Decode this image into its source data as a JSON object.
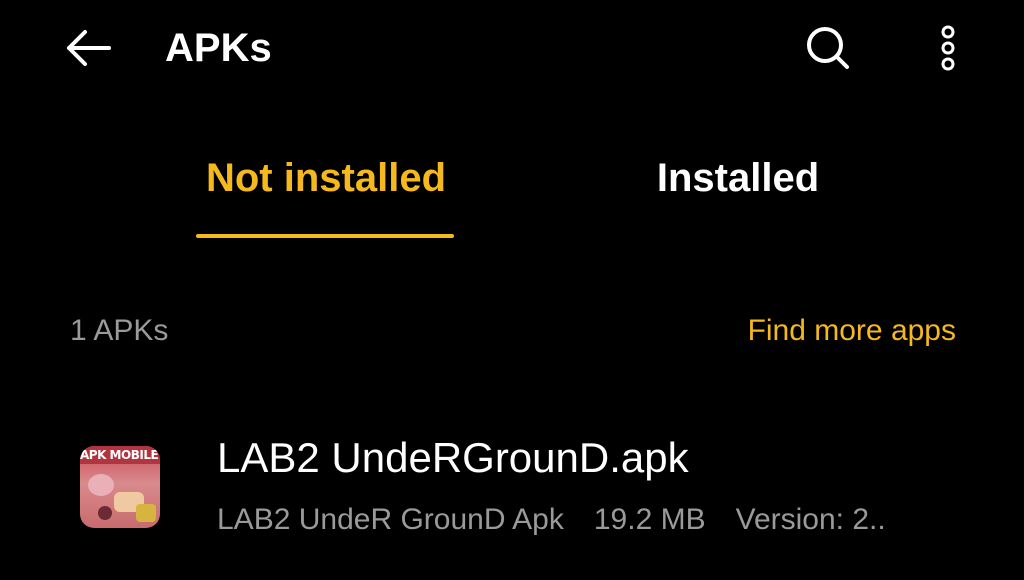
{
  "appbar": {
    "title": "APKs",
    "back_icon": "back-arrow-icon",
    "search_icon": "search-icon",
    "more_icon": "more-vertical-icon"
  },
  "tabs": [
    {
      "label": "Not installed",
      "selected": true
    },
    {
      "label": "Installed",
      "selected": false
    }
  ],
  "section": {
    "count_label": "1 APKs",
    "find_more_label": "Find more apps"
  },
  "apks": [
    {
      "icon_text": "APK MOBILE",
      "file_name": "LAB2 UndeRGrounD.apk",
      "app_name": "LAB2 UndeR GrounD Apk",
      "size": "19.2 MB",
      "version": "Version: 2.."
    }
  ],
  "colors": {
    "background": "#000000",
    "accent": "#f5b81d",
    "primary_text": "#ffffff",
    "secondary_text": "#9a9a9a"
  }
}
